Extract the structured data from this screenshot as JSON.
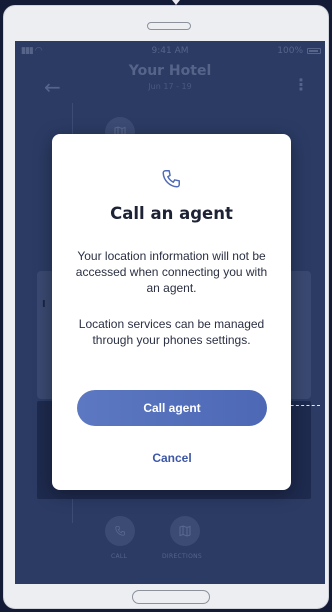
{
  "status_bar": {
    "time": "9:41 AM",
    "battery": "100%"
  },
  "header": {
    "title": "Your Hotel",
    "dates": "Jun 17 - 19"
  },
  "background_actions": {
    "call_label": "CALL",
    "directions_label": "DIRECTIONS"
  },
  "modal": {
    "icon": "phone-icon",
    "title": "Call an agent",
    "text_1": "Your location information will not be accessed when connecting you with an agent.",
    "text_2": "Location services can be managed through your phones settings.",
    "primary_label": "Call agent",
    "secondary_label": "Cancel"
  },
  "colors": {
    "accent": "#4f6ab8",
    "page_bg": "#141b36",
    "screen_dim": "#2b3b64"
  }
}
